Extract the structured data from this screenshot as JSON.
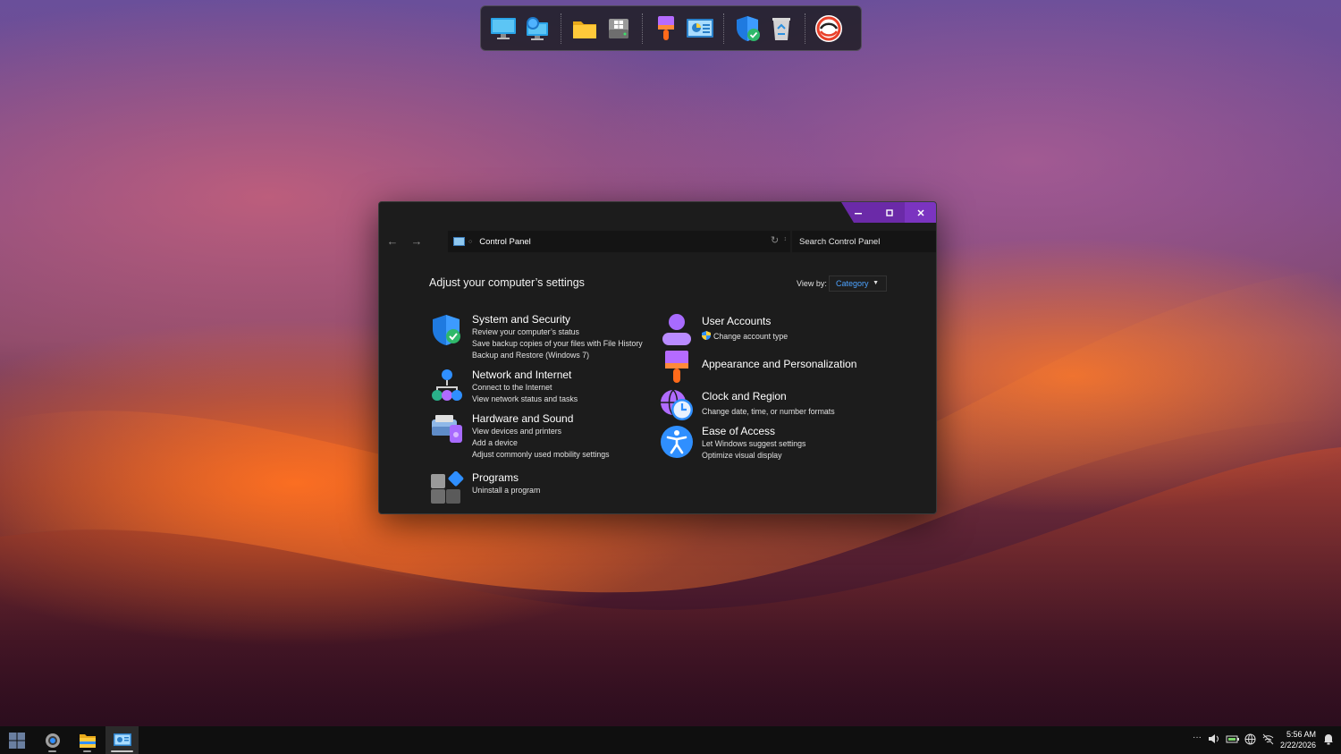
{
  "dock": {
    "items": [
      "this-pc-icon",
      "network-icon",
      "folder-icon",
      "drive-icon",
      "paint-icon",
      "control-panel-icon",
      "security-shield-icon",
      "recycle-bin-icon",
      "app-ring-icon"
    ]
  },
  "window": {
    "address": "Control Panel",
    "search_placeholder": "Search Control Panel",
    "heading": "Adjust your computer’s settings",
    "view_by_label": "View by:",
    "view_by_value": "Category",
    "categories_left": [
      {
        "title": "System and Security",
        "links": [
          "Review your computer’s status",
          "Save backup copies of your files with File History",
          "Backup and Restore (Windows 7)"
        ]
      },
      {
        "title": "Network and Internet",
        "links": [
          "Connect to the Internet",
          "View network status and tasks"
        ]
      },
      {
        "title": "Hardware and Sound",
        "links": [
          "View devices and printers",
          "Add a device",
          "Adjust commonly used mobility settings"
        ]
      },
      {
        "title": "Programs",
        "links": [
          "Uninstall a program"
        ]
      }
    ],
    "categories_right": [
      {
        "title": "User Accounts",
        "links": [
          "Change account type"
        ]
      },
      {
        "title": "Appearance and Personalization",
        "links": []
      },
      {
        "title": "Clock and Region",
        "links": [
          "Change date, time, or number formats"
        ]
      },
      {
        "title": "Ease of Access",
        "links": [
          "Let Windows suggest settings",
          "Optimize visual display"
        ]
      }
    ]
  },
  "taskbar": {
    "time": "5:56 AM",
    "date": "2/22/2026",
    "overflow": "···"
  },
  "colors": {
    "accent": "#6b2aa8",
    "link": "#4da3ff"
  }
}
